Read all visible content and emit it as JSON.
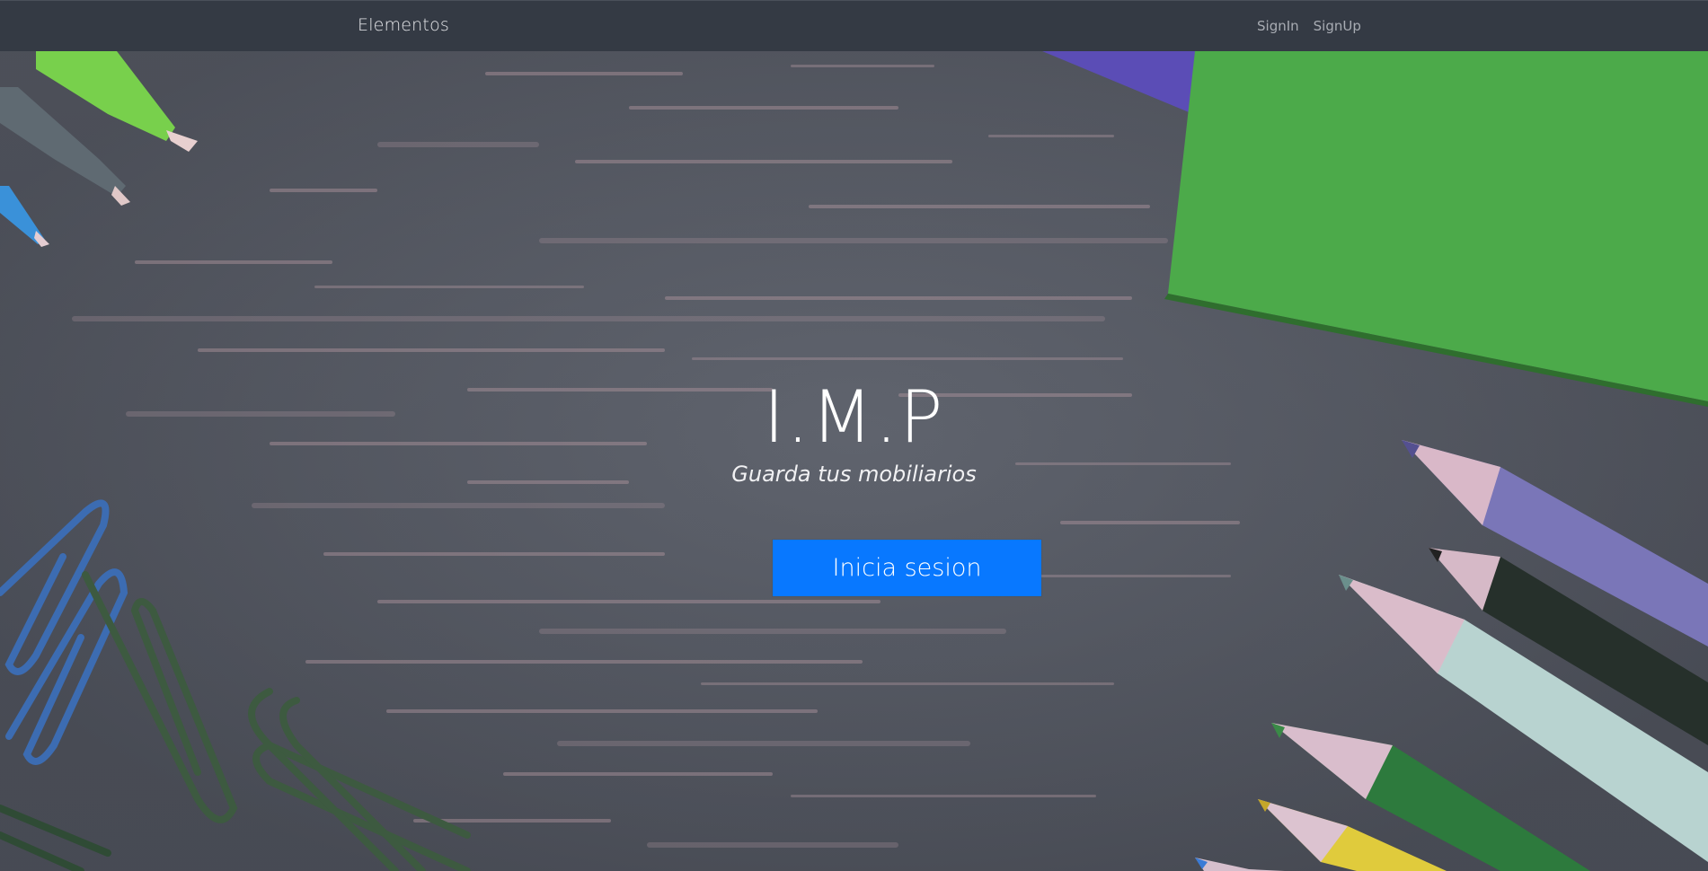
{
  "navbar": {
    "brand": "Elementos",
    "links": [
      "SignIn",
      "SignUp"
    ]
  },
  "hero": {
    "title": "I.M.P",
    "subtitle": "Guarda tus mobiliarios",
    "cta_label": "Inicia sesion"
  },
  "colors": {
    "navbar_bg": "#343a44",
    "accent": "#0878ff",
    "background": "#5a5e68",
    "notebook_green": "#4da64b",
    "notebook_purple": "#5a4bb3"
  },
  "icons": [
    "pen-icon",
    "paperclip-icon",
    "colored-pencil-icon",
    "notebook-icon"
  ]
}
